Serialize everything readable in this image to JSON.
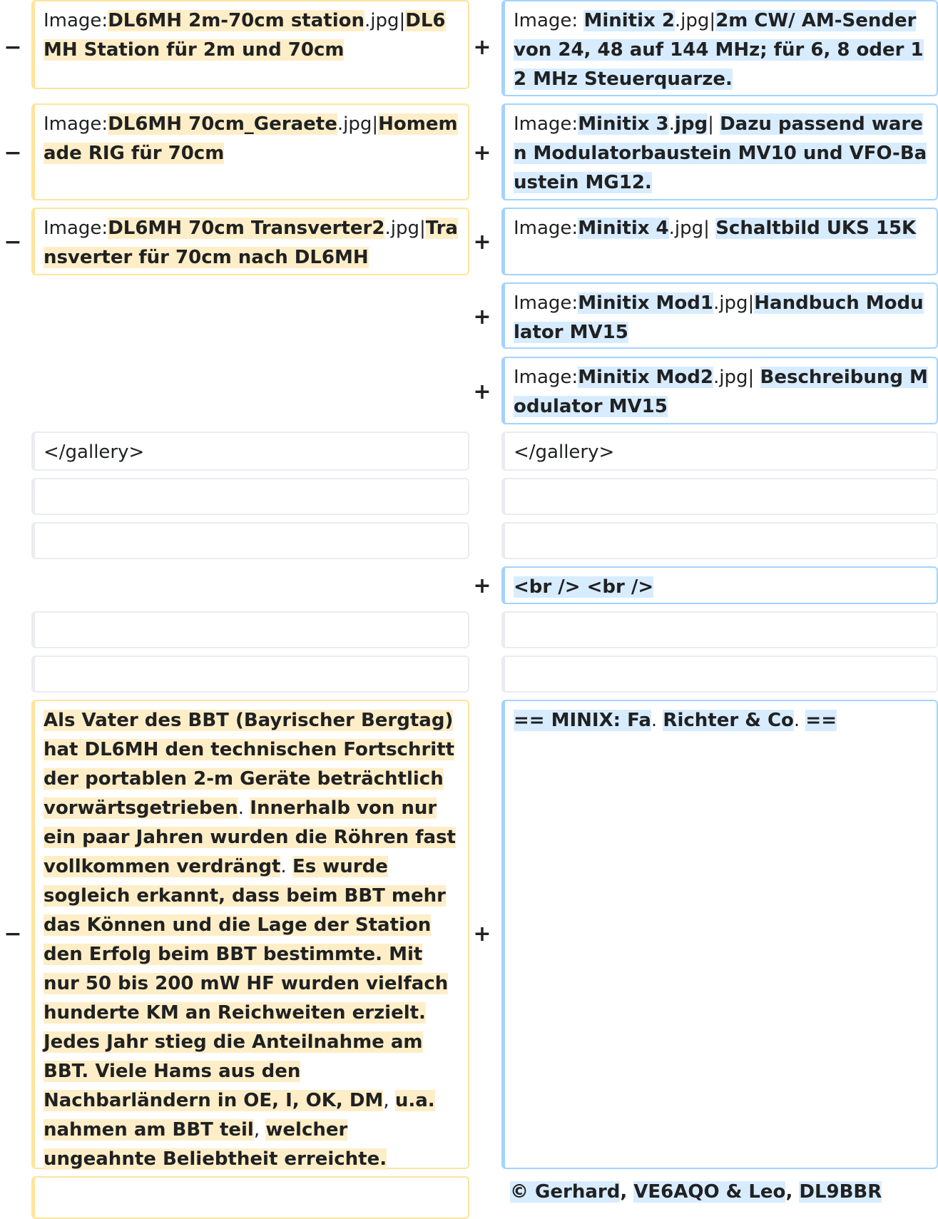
{
  "markers": {
    "minus": "−",
    "plus": "+"
  },
  "left": {
    "r1": {
      "a": "Image:",
      "b": "DL6MH 2m-70cm station",
      "c": ".jpg|",
      "d": "DL6MH Station für 2m und 70cm"
    },
    "r2": {
      "a": "Image:",
      "b": "DL6MH 70cm_Geraete",
      "c": ".jpg|",
      "d": "Homemade RIG für 70cm"
    },
    "r3": {
      "a": "Image:",
      "b": "DL6MH 70cm Transverter2",
      "c": ".jpg|",
      "d": "Transverter für 70cm nach DL6MH"
    },
    "gallery_close": "</gallery>",
    "paragraph": [
      "Als Vater des BBT (Bayrischer Bergtag) hat DL6MH den technischen Fortschritt der portablen 2-m Geräte beträchtlich vorwärtsgetrieben",
      ". ",
      "Innerhalb von nur ein paar Jahren wurden die Röhren fast vollkommen verdrängt",
      ". ",
      "Es wurde sogleich erkannt, dass beim BBT mehr das Können und die Lage der Station den Erfolg beim BBT bestimmte. Mit nur 50 bis 200 mW HF wurden vielfach hunderte KM an Reichweiten erzielt. Jedes Jahr stieg die Anteilnahme am BBT. Viele Hams aus den Nachbarländern in OE, I, OK, DM",
      ", ",
      "u.a. nahmen am BBT teil",
      ", ",
      "welcher ungeahnte Beliebtheit erreichte."
    ]
  },
  "right": {
    "r1": {
      "a": "Image: ",
      "b": "Minitix 2",
      "c": ".jpg|",
      "d": "2m CW/ AM-Sender von 24, 48 auf 144 MHz; für 6, 8 oder 12 MHz Steuerquarze."
    },
    "r2": {
      "a": "Image:",
      "b": "Minitix 3",
      "c": ".",
      "b2": "jpg",
      "c2": "| ",
      "d": "Dazu passend waren Modulatorbaustein MV10 und VFO-Baustein MG12."
    },
    "r3": {
      "a": "Image:",
      "b": "Minitix 4",
      "c": ".jpg| ",
      "d": "Schaltbild UKS 15K"
    },
    "r4": {
      "a": "Image:",
      "b": "Minitix Mod1",
      "c": ".jpg|",
      "d": "Handbuch Modulator MV15"
    },
    "r5": {
      "a": "Image:",
      "b": "Minitix Mod2",
      "c": ".jpg| ",
      "d": "Beschreibung Modulator MV15"
    },
    "gallery_close": "</gallery>",
    "br": "<br /> <br />",
    "minix": {
      "a": "== MINIX: Fa",
      "b": ". ",
      "c": "Richter & Co",
      "d": ". ",
      "e": "=="
    },
    "copyright": {
      "a": "© Gerhard",
      "b": ", ",
      "c": "VE6AQO & Leo",
      "d": ", ",
      "e": "DL9BBR"
    }
  }
}
